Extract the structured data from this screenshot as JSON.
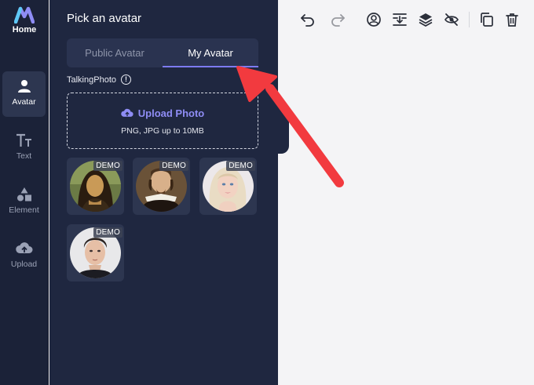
{
  "rail": {
    "home_label": "Home",
    "items": [
      {
        "label": "Avatar",
        "icon": "person-icon",
        "active": true
      },
      {
        "label": "Text",
        "icon": "text-icon",
        "active": false
      },
      {
        "label": "Element",
        "icon": "shapes-icon",
        "active": false
      },
      {
        "label": "Upload",
        "icon": "cloud-upload-icon",
        "active": false
      }
    ]
  },
  "panel": {
    "title": "Pick an avatar",
    "tabs": [
      {
        "label": "Public Avatar",
        "active": false
      },
      {
        "label": "My Avatar",
        "active": true
      }
    ],
    "section_label": "TalkingPhoto",
    "info_glyph": "!",
    "upload": {
      "label": "Upload Photo",
      "hint": "PNG, JPG up to 10MB"
    },
    "avatars": [
      {
        "badge": "DEMO",
        "subject": "mona-lisa"
      },
      {
        "badge": "DEMO",
        "subject": "shakespeare"
      },
      {
        "badge": "DEMO",
        "subject": "blonde-woman"
      },
      {
        "badge": "DEMO",
        "subject": "young-man"
      }
    ]
  },
  "toolbar": {
    "tools": [
      "undo-icon",
      "redo-icon",
      "avatar-circle-icon",
      "align-icon",
      "layers-icon",
      "hide-icon",
      "duplicate-icon",
      "delete-icon"
    ]
  },
  "colors": {
    "rail_bg": "#1b2238",
    "panel_bg": "#1f2740",
    "accent": "#7d7bf0",
    "annotation_arrow": "#f23a3f",
    "canvas_bg": "#f4f4f6"
  }
}
